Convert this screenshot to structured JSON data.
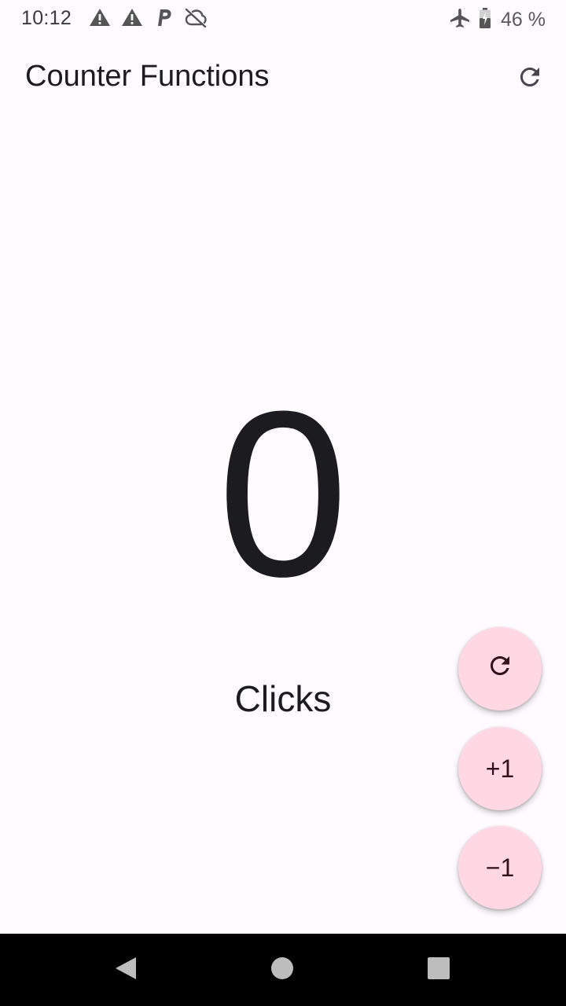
{
  "status_bar": {
    "time": "10:12",
    "battery_text": "46 %",
    "left_icons": [
      "warning-icon",
      "warning-icon",
      "parking-icon",
      "cloud-off-icon"
    ],
    "right_icons": [
      "airplane-icon",
      "battery-icon"
    ]
  },
  "app_bar": {
    "title": "Counter Functions",
    "action_icon": "refresh-icon"
  },
  "counter": {
    "value": "0",
    "label": "Clicks"
  },
  "fabs": {
    "reset_icon": "refresh-icon",
    "increment_label": "+1",
    "decrement_label": "−1",
    "background": "#ffd8e4",
    "foreground": "#31111d"
  },
  "nav_bar": {
    "icons": [
      "back-icon",
      "home-icon",
      "recents-icon"
    ]
  },
  "colors": {
    "background": "#fffbfe",
    "text": "#1c1b1f",
    "nav_bar": "#000000"
  }
}
